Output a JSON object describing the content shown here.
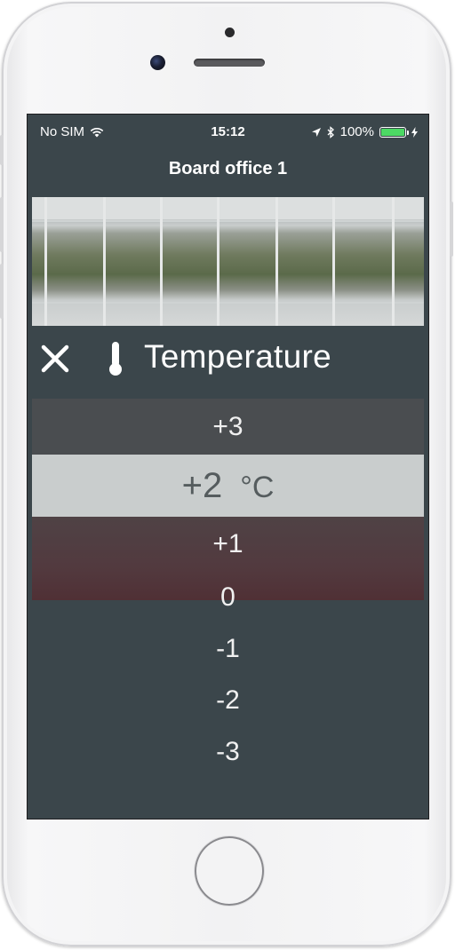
{
  "status_bar": {
    "carrier": "No SIM",
    "time": "15:12",
    "battery_percent": "100%",
    "battery_level": 1.0,
    "battery_color": "#4cd964"
  },
  "nav": {
    "title": "Board office 1"
  },
  "control": {
    "close_icon": "close-icon",
    "thermo_icon": "thermometer-icon",
    "title": "Temperature"
  },
  "picker": {
    "options": [
      "+3",
      "+2",
      "+1",
      "0",
      "-1",
      "-2",
      "-3"
    ],
    "selected_value": "+2",
    "unit": "°C",
    "selected_bg": "#c9cdcd"
  }
}
